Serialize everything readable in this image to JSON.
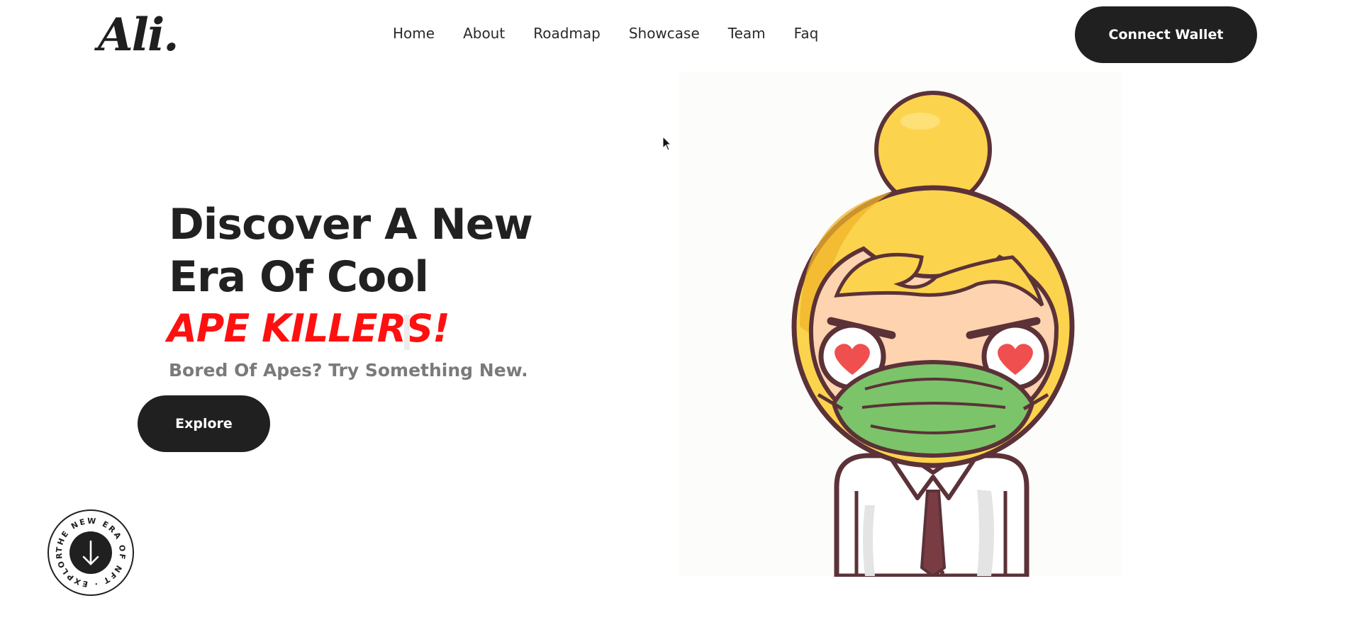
{
  "header": {
    "logo": "Ali.",
    "nav": [
      "Home",
      "About",
      "Roadmap",
      "Showcase",
      "Team",
      "Faq"
    ],
    "connect_label": "Connect Wallet"
  },
  "hero": {
    "title": "Discover A New Era Of Cool",
    "highlight": "APE KILLERS!",
    "subtitle": "Bored Of Apes? Try Something New.",
    "explore_label": "Explore"
  },
  "badge": {
    "ring_text": "THE NEW ERA OF NFT · EXPLORE ·"
  },
  "colors": {
    "dark": "#202020",
    "highlight_red": "#ff1010",
    "hair_yellow": "#fcd34d",
    "mask_green": "#7cc46a",
    "heart_red": "#ef4f4f",
    "outline": "#5b3238"
  },
  "icons": [
    "arrow-down-icon",
    "mouse-pointer-icon"
  ]
}
